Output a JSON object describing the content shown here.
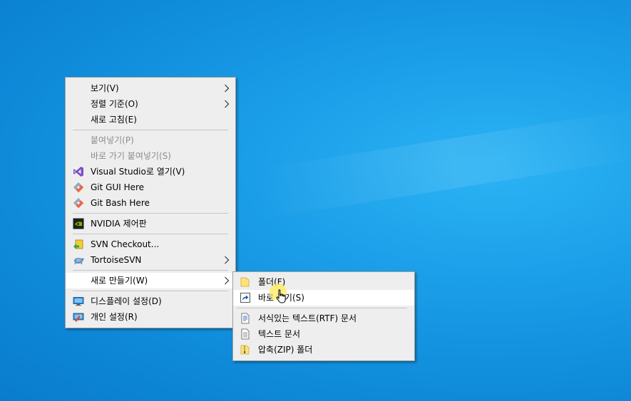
{
  "context_menu": {
    "items": [
      {
        "label": "보기(V)"
      },
      {
        "label": "정렬 기준(O)"
      },
      {
        "label": "새로 고침(E)"
      },
      {
        "label": "붙여넣기(P)"
      },
      {
        "label": "바로 가기 붙여넣기(S)"
      },
      {
        "label": "Visual Studio로 열기(V)",
        "icon": "visual-studio-icon"
      },
      {
        "label": "Git GUI Here",
        "icon": "git-icon"
      },
      {
        "label": "Git Bash Here",
        "icon": "git-icon"
      },
      {
        "label": "NVIDIA 제어판",
        "icon": "nvidia-icon"
      },
      {
        "label": "SVN Checkout...",
        "icon": "svn-checkout-icon"
      },
      {
        "label": "TortoiseSVN",
        "icon": "tortoisesvn-icon"
      },
      {
        "label": "새로 만들기(W)"
      },
      {
        "label": "디스플레이 설정(D)",
        "icon": "display-icon"
      },
      {
        "label": "개인 설정(R)",
        "icon": "personalize-icon"
      }
    ]
  },
  "submenu": {
    "items": [
      {
        "label": "폴더(F)",
        "icon": "folder-icon"
      },
      {
        "label": "바로 가기(S)",
        "icon": "shortcut-icon"
      },
      {
        "label": "서식있는 텍스트(RTF) 문서",
        "icon": "rtf-document-icon"
      },
      {
        "label": "텍스트 문서",
        "icon": "text-document-icon"
      },
      {
        "label": "압축(ZIP) 폴더",
        "icon": "zip-folder-icon"
      }
    ]
  },
  "colors": {
    "desktop": "#0e8ad9",
    "menu_bg": "#eeeeee",
    "highlight": "#ffffff",
    "disabled_text": "#8d8d8d"
  }
}
